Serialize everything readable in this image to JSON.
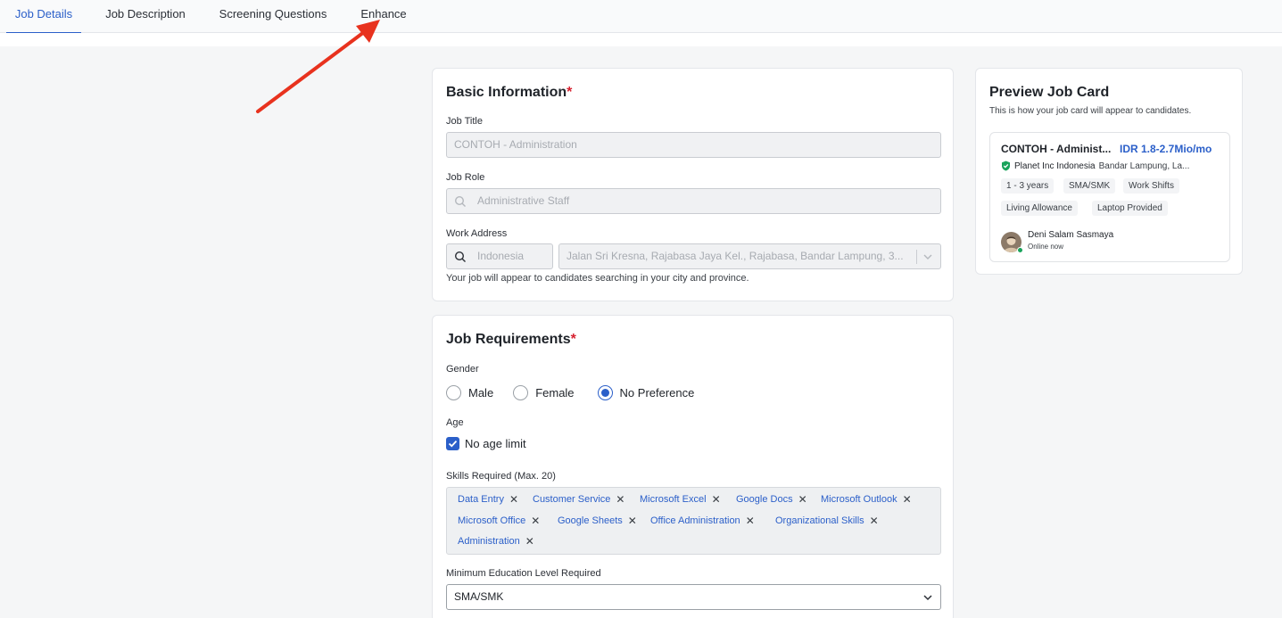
{
  "tabs": [
    {
      "label": "Job Details",
      "active": true
    },
    {
      "label": "Job Description",
      "active": false
    },
    {
      "label": "Screening Questions",
      "active": false
    },
    {
      "label": "Enhance",
      "active": false
    }
  ],
  "basic": {
    "title": "Basic Information",
    "required_mark": "*",
    "job_title_label": "Job Title",
    "job_title_value": "CONTOH - Administration",
    "job_role_label": "Job Role",
    "job_role_value": "Administrative Staff",
    "address_label": "Work Address",
    "country_value": "Indonesia",
    "address_value": "Jalan Sri Kresna, Rajabasa Jaya Kel., Rajabasa, Bandar Lampung, 3...",
    "address_hint": "Your job will appear to candidates searching in your city and province."
  },
  "requirements": {
    "title": "Job Requirements",
    "required_mark": "*",
    "gender_label": "Gender",
    "gender_options": [
      "Male",
      "Female",
      "No Preference"
    ],
    "gender_selected": "No Preference",
    "age_label": "Age",
    "age_checkbox_label": "No age limit",
    "age_checked": true,
    "skills_label": "Skills Required (Max. 20)",
    "skills": [
      "Data Entry",
      "Customer Service",
      "Microsoft Excel",
      "Google Docs",
      "Microsoft Outlook",
      "Microsoft Office",
      "Google Sheets",
      "Office Administration",
      "Organizational Skills",
      "Administration"
    ],
    "education_label": "Minimum Education Level Required",
    "education_value": "SMA/SMK"
  },
  "preview": {
    "title": "Preview Job Card",
    "subtitle": "This is how your job card will appear to candidates.",
    "job_title": "CONTOH - Administ...",
    "salary": "IDR 1.8-2.7Mio/mo",
    "company": "Planet Inc Indonesia",
    "location": "Bandar Lampung, La...",
    "tags": [
      "1 - 3 years",
      "SMA/SMK",
      "Work Shifts",
      "Living Allowance",
      "Laptop Provided"
    ],
    "recruiter": "Deni Salam Sasmaya",
    "status": "Online now"
  },
  "colors": {
    "accent": "#2b5fc9",
    "required": "#d6212f",
    "arrow": "#e8321e",
    "verified": "#19a35b"
  }
}
